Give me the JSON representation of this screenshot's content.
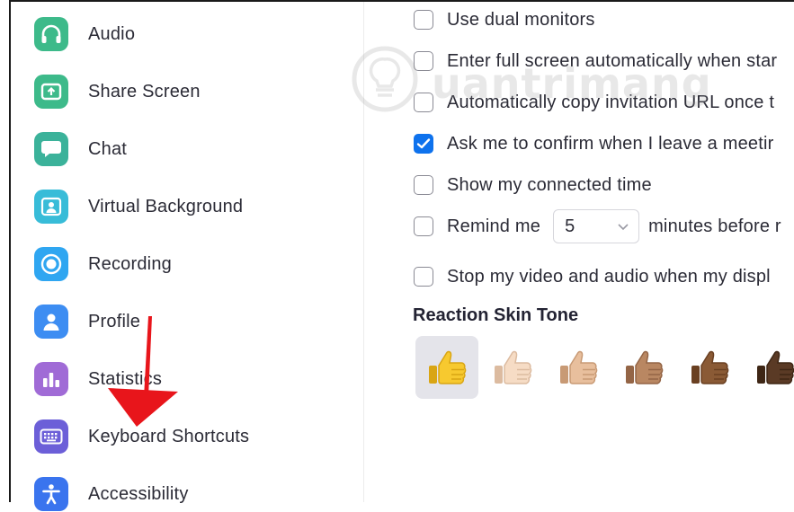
{
  "sidebar": {
    "items": [
      {
        "label": "Audio",
        "icon": "headphones-icon",
        "color": "#3dba8a"
      },
      {
        "label": "Share Screen",
        "icon": "share-screen-icon",
        "color": "#3dba8a"
      },
      {
        "label": "Chat",
        "icon": "chat-icon",
        "color": "#3bb29a"
      },
      {
        "label": "Virtual Background",
        "icon": "person-frame-icon",
        "color": "#38bcd8"
      },
      {
        "label": "Recording",
        "icon": "record-icon",
        "color": "#2fa6f1"
      },
      {
        "label": "Profile",
        "icon": "person-icon",
        "color": "#3d8df2"
      },
      {
        "label": "Statistics",
        "icon": "bar-chart-icon",
        "color": "#a06bd6"
      },
      {
        "label": "Keyboard Shortcuts",
        "icon": "keyboard-icon",
        "color": "#6c5fd8"
      },
      {
        "label": "Accessibility",
        "icon": "accessibility-icon",
        "color": "#3a74ee"
      }
    ]
  },
  "settings": {
    "dual_monitors": {
      "label": "Use dual monitors",
      "checked": false
    },
    "full_screen": {
      "label": "Enter full screen automatically when star",
      "checked": false
    },
    "copy_url": {
      "label": "Automatically copy invitation URL once t",
      "checked": false
    },
    "confirm_leave": {
      "label": "Ask me to confirm when I leave a meetir",
      "checked": true
    },
    "connected_time": {
      "label": "Show my connected time",
      "checked": false
    },
    "remind": {
      "label_before": "Remind me",
      "minutes": "5",
      "label_after": "minutes before r",
      "checked": false
    },
    "stop_video": {
      "label": "Stop my video and audio when my displ",
      "checked": false
    }
  },
  "reaction": {
    "title": "Reaction Skin Tone",
    "tones": [
      {
        "name": "default-yellow",
        "color": "#f7c92f",
        "dark": "#d9a514",
        "selected": true
      },
      {
        "name": "light",
        "color": "#f6dcc5",
        "dark": "#dcbba0",
        "selected": false
      },
      {
        "name": "medium-light",
        "color": "#e8bf9d",
        "dark": "#c89a75",
        "selected": false
      },
      {
        "name": "medium",
        "color": "#b98762",
        "dark": "#946546",
        "selected": false
      },
      {
        "name": "medium-dark",
        "color": "#8a5a35",
        "dark": "#6a4022",
        "selected": false
      },
      {
        "name": "dark",
        "color": "#5a3a25",
        "dark": "#3e2615",
        "selected": false
      }
    ]
  },
  "colors": {
    "accent": "#0e72ed",
    "annotation_arrow": "#e8151b"
  }
}
